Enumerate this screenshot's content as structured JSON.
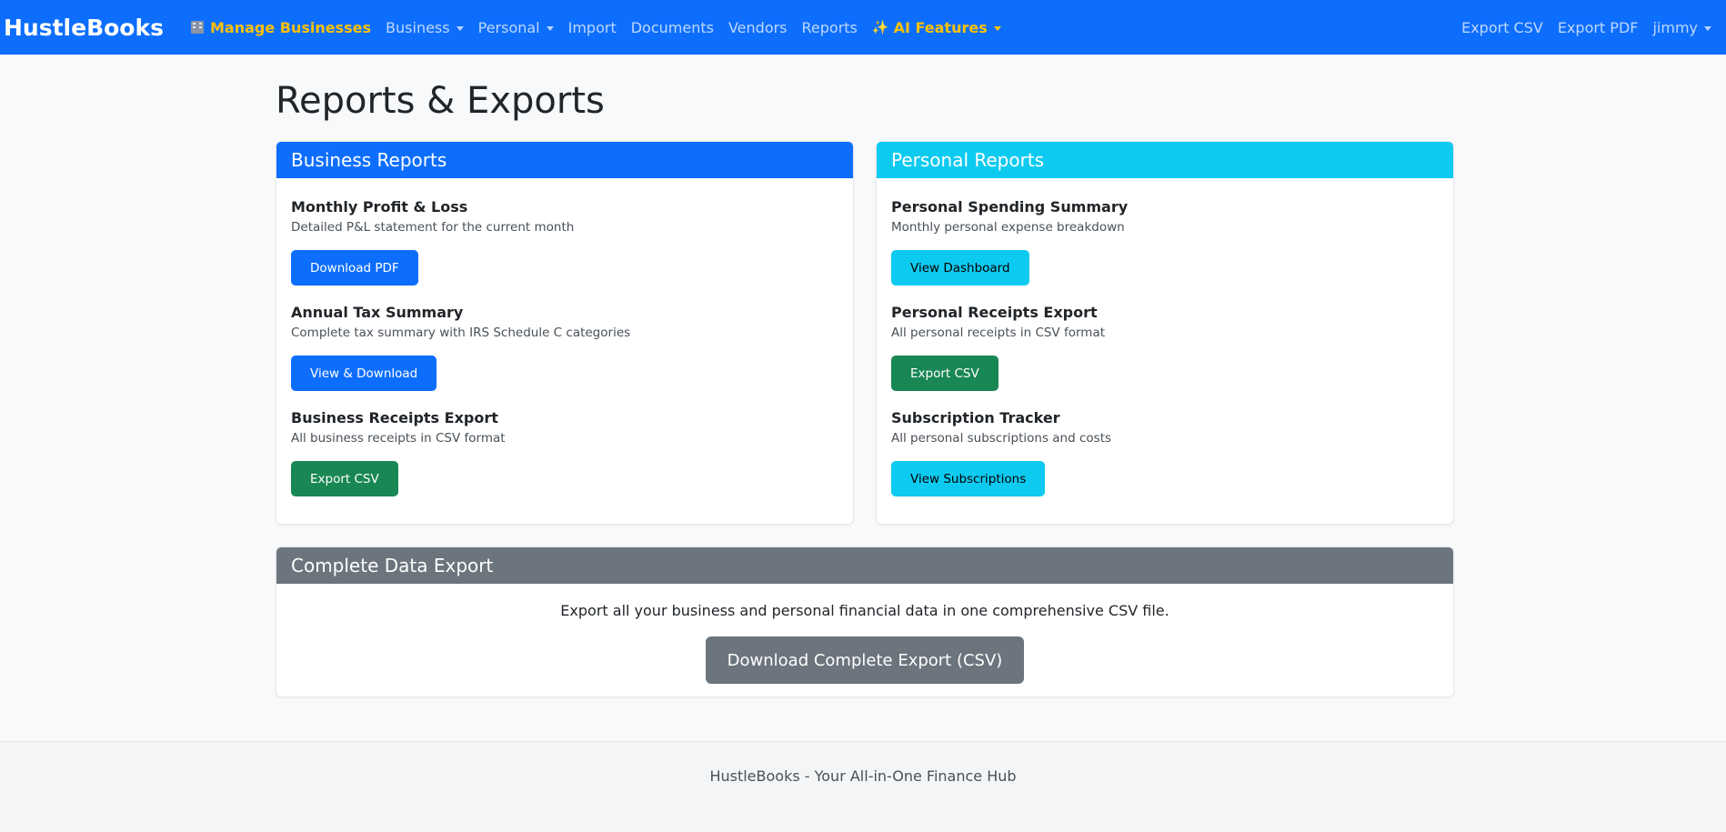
{
  "navbar": {
    "brand": "HustleBooks",
    "left_items": [
      {
        "label": "Manage Businesses",
        "icon": "building-icon",
        "highlight": true,
        "dropdown": false
      },
      {
        "label": "Business",
        "dropdown": true
      },
      {
        "label": "Personal",
        "dropdown": true
      },
      {
        "label": "Import",
        "dropdown": false
      },
      {
        "label": "Documents",
        "dropdown": false
      },
      {
        "label": "Vendors",
        "dropdown": false
      },
      {
        "label": "Reports",
        "dropdown": false
      },
      {
        "label": "AI Features",
        "icon": "sparkle-icon",
        "highlight": true,
        "dropdown": true
      }
    ],
    "right_items": [
      {
        "label": "Export CSV"
      },
      {
        "label": "Export PDF"
      },
      {
        "label": "jimmy",
        "dropdown": true
      }
    ],
    "colors": {
      "background": "#0d6efd",
      "highlight": "#ffc107"
    }
  },
  "page": {
    "title": "Reports & Exports"
  },
  "business_reports": {
    "header": "Business Reports",
    "items": [
      {
        "title": "Monthly Profit & Loss",
        "description": "Detailed P&L statement for the current month",
        "button": "Download PDF"
      },
      {
        "title": "Annual Tax Summary",
        "description": "Complete tax summary with IRS Schedule C categories",
        "button": "View & Download"
      },
      {
        "title": "Business Receipts Export",
        "description": "All business receipts in CSV format",
        "button": "Export CSV"
      }
    ]
  },
  "personal_reports": {
    "header": "Personal Reports",
    "items": [
      {
        "title": "Personal Spending Summary",
        "description": "Monthly personal expense breakdown",
        "button": "View Dashboard"
      },
      {
        "title": "Personal Receipts Export",
        "description": "All personal receipts in CSV format",
        "button": "Export CSV"
      },
      {
        "title": "Subscription Tracker",
        "description": "All personal subscriptions and costs",
        "button": "View Subscriptions"
      }
    ]
  },
  "complete_export": {
    "header": "Complete Data Export",
    "description": "Export all your business and personal financial data in one comprehensive CSV file.",
    "button": "Download Complete Export (CSV)"
  },
  "footer": {
    "text": "HustleBooks - Your All-in-One Finance Hub"
  }
}
